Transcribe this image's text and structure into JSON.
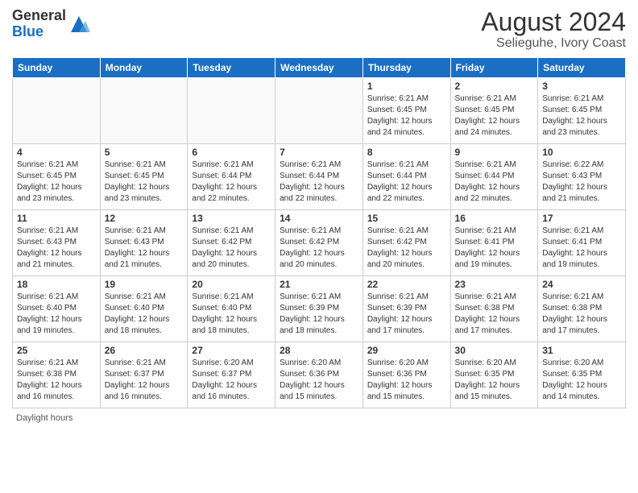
{
  "header": {
    "logo_general": "General",
    "logo_blue": "Blue",
    "month_year": "August 2024",
    "location": "Selieguhe, Ivory Coast"
  },
  "footer": {
    "daylight_hours": "Daylight hours"
  },
  "days_of_week": [
    "Sunday",
    "Monday",
    "Tuesday",
    "Wednesday",
    "Thursday",
    "Friday",
    "Saturday"
  ],
  "weeks": [
    [
      {
        "day": "",
        "info": ""
      },
      {
        "day": "",
        "info": ""
      },
      {
        "day": "",
        "info": ""
      },
      {
        "day": "",
        "info": ""
      },
      {
        "day": "1",
        "info": "Sunrise: 6:21 AM\nSunset: 6:45 PM\nDaylight: 12 hours and 24 minutes."
      },
      {
        "day": "2",
        "info": "Sunrise: 6:21 AM\nSunset: 6:45 PM\nDaylight: 12 hours and 24 minutes."
      },
      {
        "day": "3",
        "info": "Sunrise: 6:21 AM\nSunset: 6:45 PM\nDaylight: 12 hours and 23 minutes."
      }
    ],
    [
      {
        "day": "4",
        "info": "Sunrise: 6:21 AM\nSunset: 6:45 PM\nDaylight: 12 hours and 23 minutes."
      },
      {
        "day": "5",
        "info": "Sunrise: 6:21 AM\nSunset: 6:45 PM\nDaylight: 12 hours and 23 minutes."
      },
      {
        "day": "6",
        "info": "Sunrise: 6:21 AM\nSunset: 6:44 PM\nDaylight: 12 hours and 22 minutes."
      },
      {
        "day": "7",
        "info": "Sunrise: 6:21 AM\nSunset: 6:44 PM\nDaylight: 12 hours and 22 minutes."
      },
      {
        "day": "8",
        "info": "Sunrise: 6:21 AM\nSunset: 6:44 PM\nDaylight: 12 hours and 22 minutes."
      },
      {
        "day": "9",
        "info": "Sunrise: 6:21 AM\nSunset: 6:44 PM\nDaylight: 12 hours and 22 minutes."
      },
      {
        "day": "10",
        "info": "Sunrise: 6:22 AM\nSunset: 6:43 PM\nDaylight: 12 hours and 21 minutes."
      }
    ],
    [
      {
        "day": "11",
        "info": "Sunrise: 6:21 AM\nSunset: 6:43 PM\nDaylight: 12 hours and 21 minutes."
      },
      {
        "day": "12",
        "info": "Sunrise: 6:21 AM\nSunset: 6:43 PM\nDaylight: 12 hours and 21 minutes."
      },
      {
        "day": "13",
        "info": "Sunrise: 6:21 AM\nSunset: 6:42 PM\nDaylight: 12 hours and 20 minutes."
      },
      {
        "day": "14",
        "info": "Sunrise: 6:21 AM\nSunset: 6:42 PM\nDaylight: 12 hours and 20 minutes."
      },
      {
        "day": "15",
        "info": "Sunrise: 6:21 AM\nSunset: 6:42 PM\nDaylight: 12 hours and 20 minutes."
      },
      {
        "day": "16",
        "info": "Sunrise: 6:21 AM\nSunset: 6:41 PM\nDaylight: 12 hours and 19 minutes."
      },
      {
        "day": "17",
        "info": "Sunrise: 6:21 AM\nSunset: 6:41 PM\nDaylight: 12 hours and 19 minutes."
      }
    ],
    [
      {
        "day": "18",
        "info": "Sunrise: 6:21 AM\nSunset: 6:40 PM\nDaylight: 12 hours and 19 minutes."
      },
      {
        "day": "19",
        "info": "Sunrise: 6:21 AM\nSunset: 6:40 PM\nDaylight: 12 hours and 18 minutes."
      },
      {
        "day": "20",
        "info": "Sunrise: 6:21 AM\nSunset: 6:40 PM\nDaylight: 12 hours and 18 minutes."
      },
      {
        "day": "21",
        "info": "Sunrise: 6:21 AM\nSunset: 6:39 PM\nDaylight: 12 hours and 18 minutes."
      },
      {
        "day": "22",
        "info": "Sunrise: 6:21 AM\nSunset: 6:39 PM\nDaylight: 12 hours and 17 minutes."
      },
      {
        "day": "23",
        "info": "Sunrise: 6:21 AM\nSunset: 6:38 PM\nDaylight: 12 hours and 17 minutes."
      },
      {
        "day": "24",
        "info": "Sunrise: 6:21 AM\nSunset: 6:38 PM\nDaylight: 12 hours and 17 minutes."
      }
    ],
    [
      {
        "day": "25",
        "info": "Sunrise: 6:21 AM\nSunset: 6:38 PM\nDaylight: 12 hours and 16 minutes."
      },
      {
        "day": "26",
        "info": "Sunrise: 6:21 AM\nSunset: 6:37 PM\nDaylight: 12 hours and 16 minutes."
      },
      {
        "day": "27",
        "info": "Sunrise: 6:20 AM\nSunset: 6:37 PM\nDaylight: 12 hours and 16 minutes."
      },
      {
        "day": "28",
        "info": "Sunrise: 6:20 AM\nSunset: 6:36 PM\nDaylight: 12 hours and 15 minutes."
      },
      {
        "day": "29",
        "info": "Sunrise: 6:20 AM\nSunset: 6:36 PM\nDaylight: 12 hours and 15 minutes."
      },
      {
        "day": "30",
        "info": "Sunrise: 6:20 AM\nSunset: 6:35 PM\nDaylight: 12 hours and 15 minutes."
      },
      {
        "day": "31",
        "info": "Sunrise: 6:20 AM\nSunset: 6:35 PM\nDaylight: 12 hours and 14 minutes."
      }
    ]
  ]
}
